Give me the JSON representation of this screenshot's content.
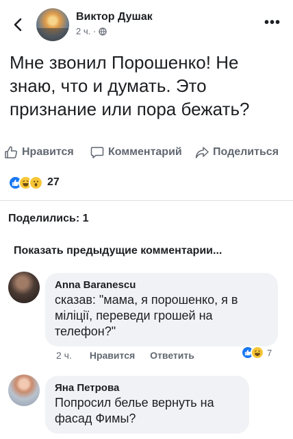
{
  "header": {
    "author": "Виктор Душак",
    "time": "2 ч. ·",
    "icons": {
      "back": "chevron-left-icon",
      "privacy": "globe-icon",
      "more": "more-icon"
    }
  },
  "post": {
    "text": "Мне звонил Порошенко! Не знаю, что и думать. Это признание или пора бежать?"
  },
  "actions": {
    "like": "Нравится",
    "comment": "Комментарий",
    "share": "Поделиться"
  },
  "reactions": {
    "types": [
      "like",
      "haha",
      "wow"
    ],
    "count": "27",
    "colors": {
      "like": "#1877f2",
      "emoji": "#f7c638"
    }
  },
  "shares": "Поделились: 1",
  "prev_comments": "Показать предыдущие комментарии...",
  "comments": [
    {
      "name": "Anna Baranescu",
      "text": "сказав: \"мама, я порошенко, я в міліції, переведи грошей на телефон?\"",
      "time": "2 ч.",
      "like": "Нравится",
      "reply": "Ответить",
      "reaction_count": "7"
    },
    {
      "name": "Яна Петрова",
      "text": "Попросил белье вернуть на фасад Фимы?"
    }
  ]
}
